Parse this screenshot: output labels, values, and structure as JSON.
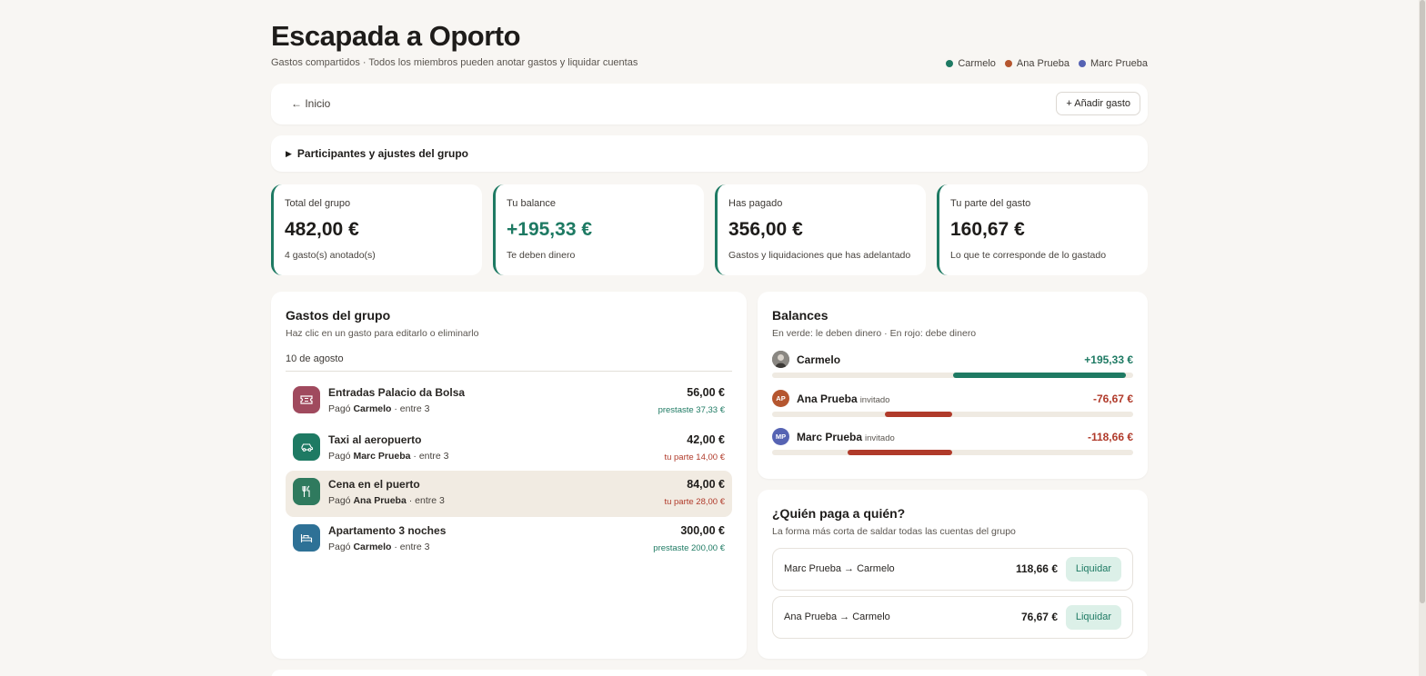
{
  "header": {
    "title": "Escapada a Oporto",
    "subtitle": "Gastos compartidos · Todos los miembros pueden anotar gastos y liquidar cuentas",
    "members": [
      {
        "name": "Carmelo",
        "color": "#1e7a63"
      },
      {
        "name": "Ana Prueba",
        "color": "#b5562f"
      },
      {
        "name": "Marc Prueba",
        "color": "#5663b3"
      }
    ]
  },
  "toolbar": {
    "back_label": "← Inicio",
    "add_label": "+ Añadir gasto"
  },
  "settings": {
    "summary": "Participantes y ajustes del grupo"
  },
  "stats": [
    {
      "label": "Total del grupo",
      "value": "482,00 €",
      "note": "4 gasto(s) anotado(s)"
    },
    {
      "label": "Tu balance",
      "value": "+195,33 €",
      "note": "Te deben dinero"
    },
    {
      "label": "Has pagado",
      "value": "356,00 €",
      "note": "Gastos y liquidaciones que has adelantado"
    },
    {
      "label": "Tu parte del gasto",
      "value": "160,67 €",
      "note": "Lo que te corresponde de lo gastado"
    }
  ],
  "expenses": {
    "title": "Gastos del grupo",
    "subtitle": "Haz clic en un gasto para editarlo o eliminarlo",
    "date": "10 de agosto",
    "items": [
      {
        "name": "Entradas Palacio da Bolsa",
        "payer_prefix": "Pagó",
        "payer": "Carmelo",
        "split": "· entre 3",
        "amount": "56,00 €",
        "share": "prestaste 37,33 €",
        "icon": "ticket-icon",
        "icon_color": "#a04a5e"
      },
      {
        "name": "Taxi al aeropuerto",
        "payer_prefix": "Pagó",
        "payer": "Marc Prueba",
        "split": "· entre 3",
        "amount": "42,00 €",
        "share": "tu parte 14,00 €",
        "icon": "car-icon",
        "icon_color": "#1e7a63"
      },
      {
        "name": "Cena en el puerto",
        "payer_prefix": "Pagó",
        "payer": "Ana Prueba",
        "split": "· entre 3",
        "amount": "84,00 €",
        "share": "tu parte 28,00 €",
        "icon": "utensils-icon",
        "icon_color": "#2f7a5e"
      },
      {
        "name": "Apartamento 3 noches",
        "payer_prefix": "Pagó",
        "payer": "Carmelo",
        "split": "· entre 3",
        "amount": "300,00 €",
        "share": "prestaste 200,00 €",
        "icon": "bed-icon",
        "icon_color": "#2e7196"
      }
    ]
  },
  "balances": {
    "title": "Balances",
    "subtitle": "En verde: le deben dinero · En rojo: debe dinero",
    "items": [
      {
        "name": "Carmelo",
        "tag": "",
        "initials": "",
        "amount": "+195,33 €",
        "value": 195.33,
        "color": "#1e7a63"
      },
      {
        "name": "Ana Prueba",
        "tag": "invitado",
        "initials": "AP",
        "amount": "-76,67 €",
        "value": -76.67,
        "color": "#b03a2a"
      },
      {
        "name": "Marc Prueba",
        "tag": "invitado",
        "initials": "MP",
        "amount": "-118,66 €",
        "value": -118.66,
        "color": "#b03a2a"
      }
    ]
  },
  "settle": {
    "title": "¿Quién paga a quién?",
    "subtitle": "La forma más corta de saldar todas las cuentas del grupo",
    "items": [
      {
        "text": "Marc Prueba → Carmelo",
        "amount": "118,66 €",
        "action": "Liquidar"
      },
      {
        "text": "Ana Prueba → Carmelo",
        "amount": "76,67 €",
        "action": "Liquidar"
      }
    ]
  }
}
